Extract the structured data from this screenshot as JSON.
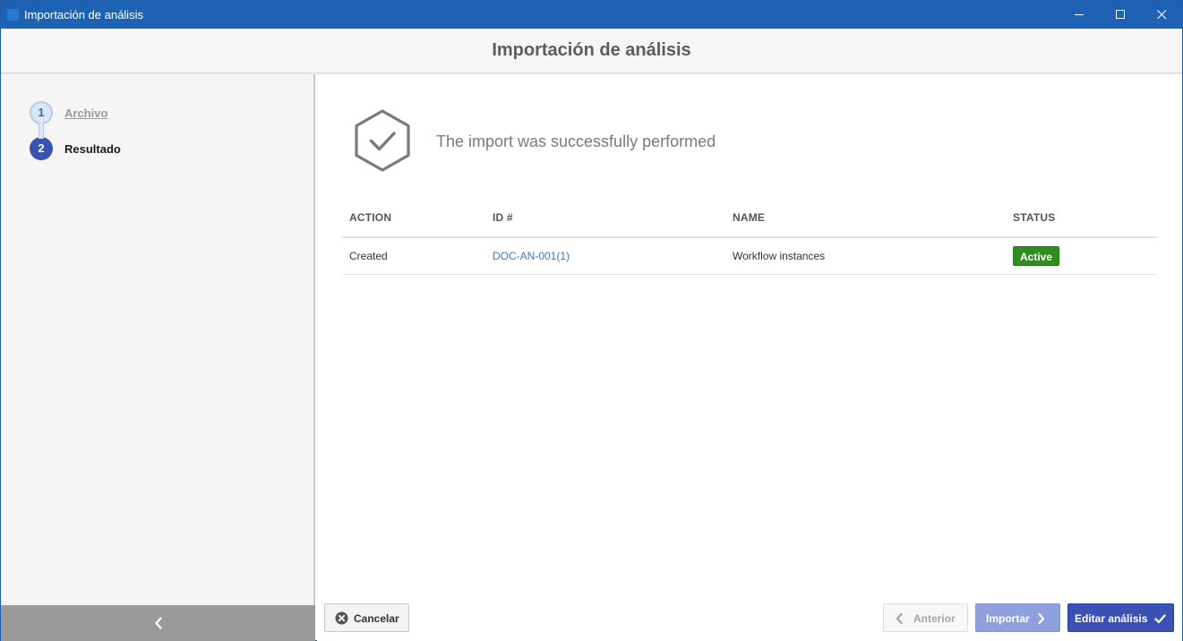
{
  "window": {
    "title": "Importación de análisis"
  },
  "header": {
    "title": "Importación de análisis"
  },
  "steps": [
    {
      "number": "1",
      "label": "Archivo"
    },
    {
      "number": "2",
      "label": "Resultado"
    }
  ],
  "result": {
    "message": "The import was successfully performed"
  },
  "table": {
    "columns": [
      "ACTION",
      "ID #",
      "NAME",
      "STATUS"
    ],
    "rows": [
      {
        "action": "Created",
        "id": "DOC-AN-001(1)",
        "name": "Workflow instances",
        "status": "Active"
      }
    ]
  },
  "buttons": {
    "cancel": "Cancelar",
    "previous": "Anterior",
    "import": "Importar",
    "edit": "Editar análisis"
  },
  "icons": {
    "app": "app-icon",
    "minimize": "minimize-icon",
    "maximize": "maximize-icon",
    "close": "close-icon",
    "success": "hexagon-check-icon",
    "collapse": "chevron-left-icon",
    "cancel": "close-circle-icon",
    "previous": "chevron-left-icon",
    "import": "chevron-right-icon",
    "edit": "check-icon"
  },
  "colors": {
    "titlebar": "#1e63b3",
    "accent": "#3a52b0",
    "status_active": "#2f8f1e",
    "link": "#3b74c9"
  }
}
